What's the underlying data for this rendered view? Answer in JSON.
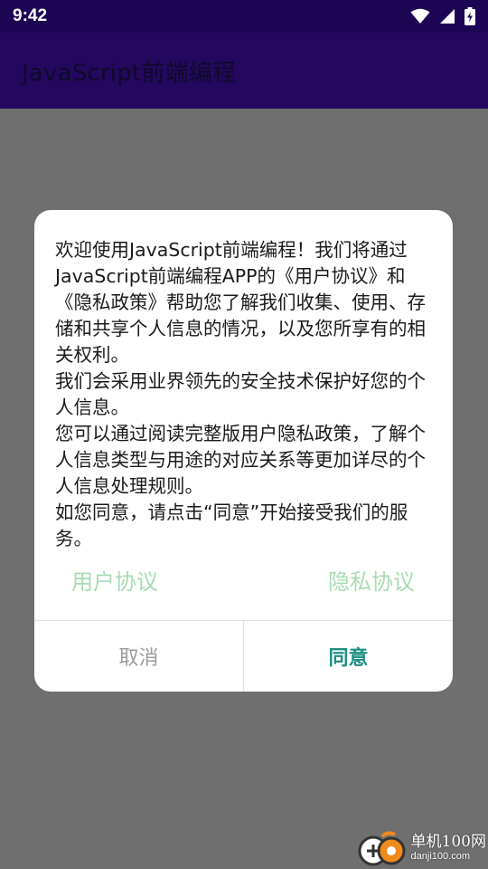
{
  "status_bar": {
    "time": "9:42",
    "icons": [
      "wifi-icon",
      "cell-signal-icon",
      "battery-charging-icon"
    ]
  },
  "app_bar": {
    "title": "JavaScript前端编程"
  },
  "dialog": {
    "paragraphs": [
      "欢迎使用JavaScript前端编程！我们将通过JavaScript前端编程APP的《用户协议》和《隐私政策》帮助您了解我们收集、使用、存储和共享个人信息的情况，以及您所享有的相关权利。",
      "我们会采用业界领先的安全技术保护好您的个人信息。",
      "您可以通过阅读完整版用户隐私政策，了解个人信息类型与用途的对应关系等更加详尽的个人信息处理规则。",
      "如您同意，请点击“同意”开始接受我们的服务。"
    ],
    "user_agreement_link": "用户协议",
    "privacy_agreement_link": "隐私协议",
    "cancel_label": "取消",
    "agree_label": "同意"
  },
  "watermark": {
    "cn": "单机100网",
    "en": "danji100.com"
  },
  "colors": {
    "status_bar_bg": "#1c0654",
    "app_bar_bg": "#24085f",
    "scrim": "#6f6f6f",
    "link": "#a8dbb2",
    "agree": "#1f8f83",
    "cancel": "#9b9b9b"
  }
}
